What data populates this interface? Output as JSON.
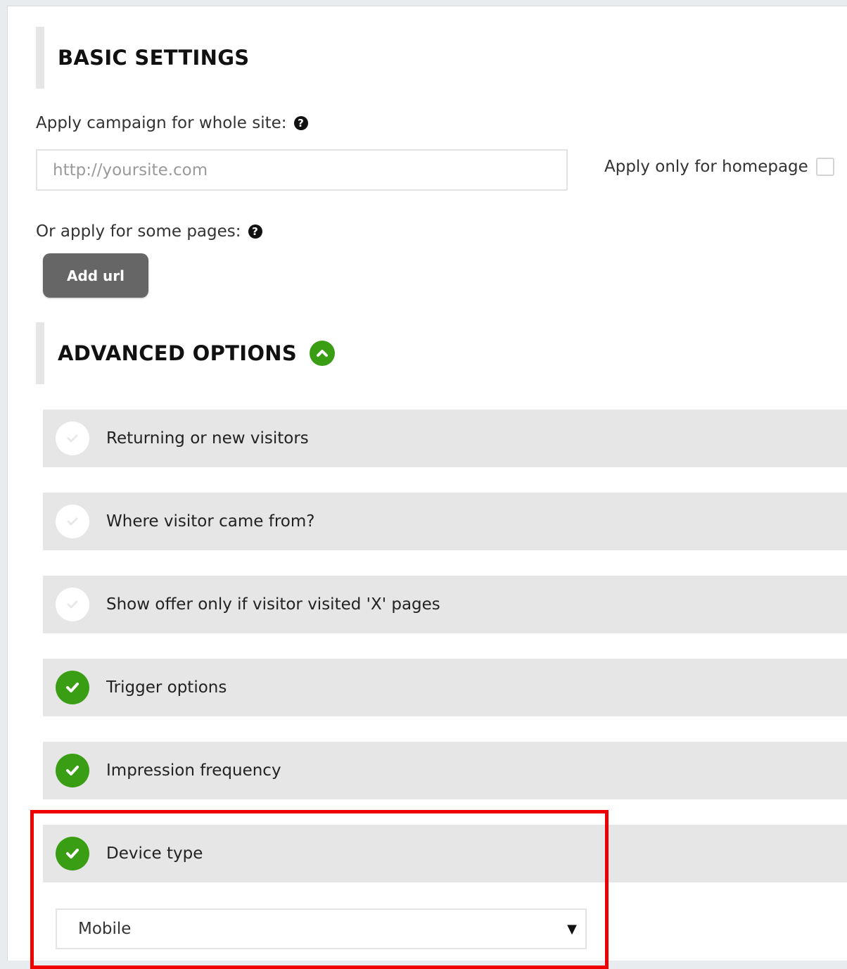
{
  "basic_settings": {
    "title": "BASIC SETTINGS",
    "whole_site_label": "Apply campaign for whole site:",
    "url_placeholder": "http://yoursite.com",
    "url_value": "",
    "homepage_label": "Apply only for homepage",
    "homepage_checked": false,
    "some_pages_label": "Or apply for some pages:",
    "add_url_label": "Add url",
    "help_glyph": "?"
  },
  "advanced_options": {
    "title": "ADVANCED OPTIONS",
    "toggle_icon": "chevron-up-circle-icon",
    "items": [
      {
        "label": "Returning or new visitors",
        "enabled": false
      },
      {
        "label": "Where visitor came from?",
        "enabled": false
      },
      {
        "label": "Show offer only if visitor visited 'X' pages",
        "enabled": false
      },
      {
        "label": "Trigger options",
        "enabled": true
      },
      {
        "label": "Impression frequency",
        "enabled": true
      },
      {
        "label": "Device type",
        "enabled": true
      }
    ],
    "device_type_value": "Mobile",
    "caret_glyph": "▼"
  },
  "colors": {
    "accent_green": "#3a9e14",
    "highlight_red": "#ee0000",
    "button_gray": "#666666",
    "row_gray": "#e6e6e6"
  }
}
